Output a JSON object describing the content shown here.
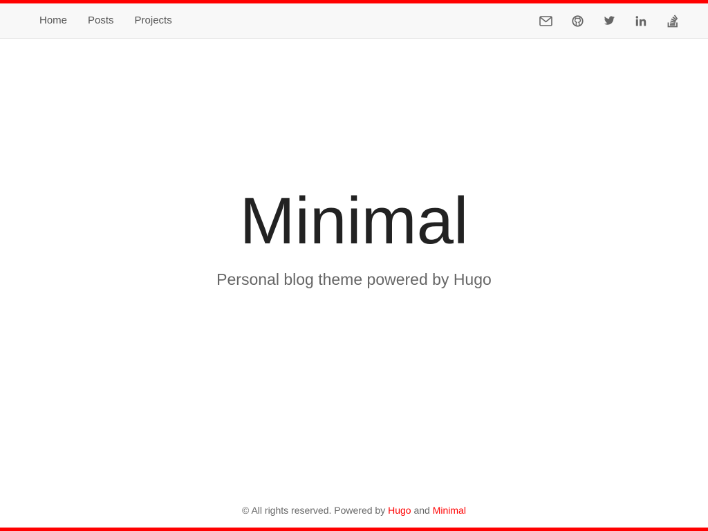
{
  "nav": {
    "items": [
      {
        "label": "Home"
      },
      {
        "label": "Posts"
      },
      {
        "label": "Projects"
      }
    ]
  },
  "social": {
    "icons": [
      "mail-icon",
      "github-icon",
      "twitter-icon",
      "linkedin-icon",
      "stackoverflow-icon"
    ],
    "icon_color": "#666666"
  },
  "hero": {
    "title": "Minimal",
    "subtitle": "Personal blog theme powered by Hugo"
  },
  "footer": {
    "prefix": "© All rights reserved. Powered by",
    "link1": "Hugo",
    "middle": "and",
    "link2": "Minimal"
  },
  "colors": {
    "accent": "#ff0000",
    "navbar_bg": "#f8f8f8",
    "nav_text": "#555555",
    "title_text": "#222222",
    "muted_text": "#666666"
  }
}
